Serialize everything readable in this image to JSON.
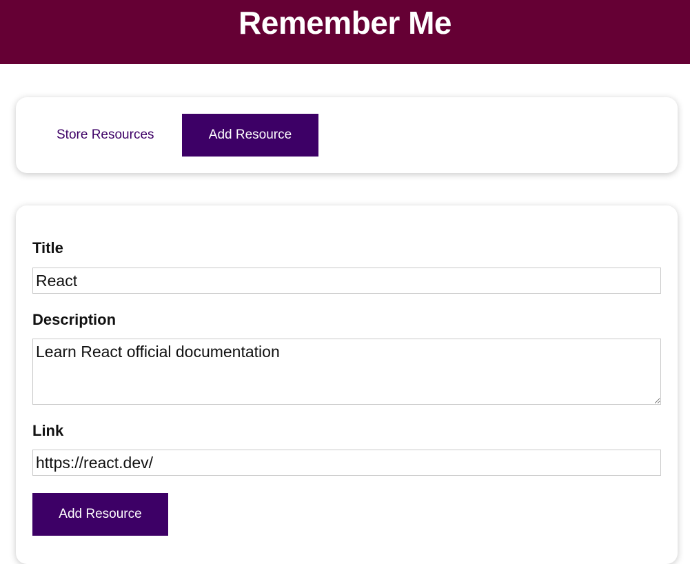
{
  "header": {
    "title": "Remember Me"
  },
  "nav": {
    "store_label": "Store Resources",
    "add_label": "Add Resource"
  },
  "form": {
    "title_label": "Title",
    "title_value": "React",
    "description_label": "Description",
    "description_value": "Learn React official documentation",
    "link_label": "Link",
    "link_value": "https://react.dev/",
    "submit_label": "Add Resource"
  },
  "colors": {
    "header_bg": "#650034",
    "accent": "#3d0066"
  }
}
